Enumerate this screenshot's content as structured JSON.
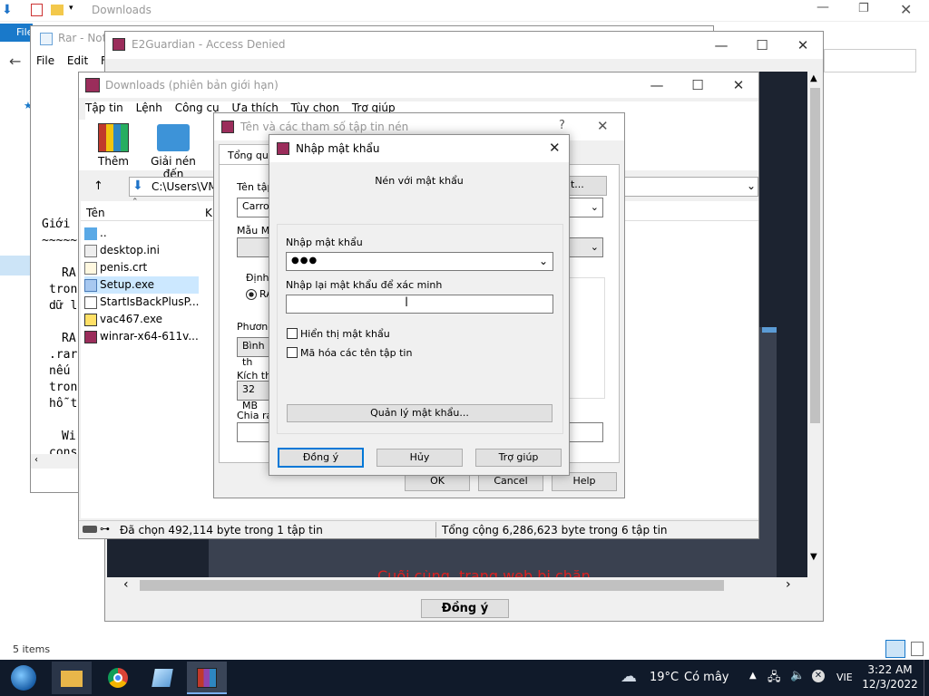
{
  "explorer": {
    "title": "Downloads",
    "file_tab": "File",
    "status_items": "5 items"
  },
  "notepad": {
    "title": "Rar - Note",
    "menu": [
      "File",
      "Edit",
      "Fo"
    ],
    "lines": [
      "Giới",
      "~~~~~",
      "RA",
      "tron",
      "dữ l",
      "RA",
      ".rar",
      "nếu",
      "tron",
      "hỗ t",
      "Wi",
      "cons"
    ]
  },
  "e2guardian": {
    "title": "E2Guardian - Access Denied",
    "ok_button": "Đồng ý",
    "red_text": "Cuối cùng, trang web bị chặn"
  },
  "winrar": {
    "title": "Downloads (phiên bản giới hạn)",
    "menu": [
      "Tập tin",
      "Lệnh",
      "Công cụ",
      "Ưa thích",
      "Tùy chọn",
      "Trợ giúp"
    ],
    "toolbar": {
      "add": "Thêm",
      "extract": "Giải nén đến"
    },
    "path": "C:\\Users\\VM5",
    "column_name": "Tên",
    "column_size": "Kí",
    "files": [
      "..",
      "desktop.ini",
      "penis.crt",
      "Setup.exe",
      "StartIsBackPlusP...",
      "vac467.exe",
      "winrar-x64-611v..."
    ],
    "status_left": "Đã chọn 492,114 byte trong 1 tập tin",
    "status_right": "Tổng cộng 6,286,623 byte trong 6 tập tin"
  },
  "archive_dialog": {
    "title": "Tên và các tham số tập tin nén",
    "tab": "Tổng quát",
    "labels": [
      "Tên tập",
      "Mẫu Mặ",
      "Định d",
      "Phương",
      "Kích thư",
      "Chia ra"
    ],
    "archive_name": "Carrol",
    "format_radio": "RA",
    "method_value": "Bình th",
    "dict_value": "32 MB",
    "set_password_button": "ật...",
    "ok": "OK",
    "cancel": "Cancel",
    "help": "Help"
  },
  "password_dialog": {
    "title": "Nhập mật khẩu",
    "heading": "Nén với mật khẩu",
    "enter_label": "Nhập mật khẩu",
    "password_value": "●●●",
    "reenter_label": "Nhập lại mật khẩu để xác minh",
    "reenter_value": "",
    "show_password": "Hiển thị mật khẩu",
    "encrypt_names": "Mã hóa các tên tập tin",
    "manage_button": "Quản lý mật khẩu...",
    "ok": "Đồng ý",
    "cancel": "Hủy",
    "help": "Trợ giúp"
  },
  "taskbar": {
    "weather_temp": "19°C",
    "weather_desc": "Có mây",
    "language": "VIE",
    "time": "3:22 AM",
    "date": "12/3/2022"
  },
  "colors": {
    "taskbar": "#101a2a",
    "dialog_accent": "#0078d7",
    "e2_bg": "#1c2330"
  }
}
